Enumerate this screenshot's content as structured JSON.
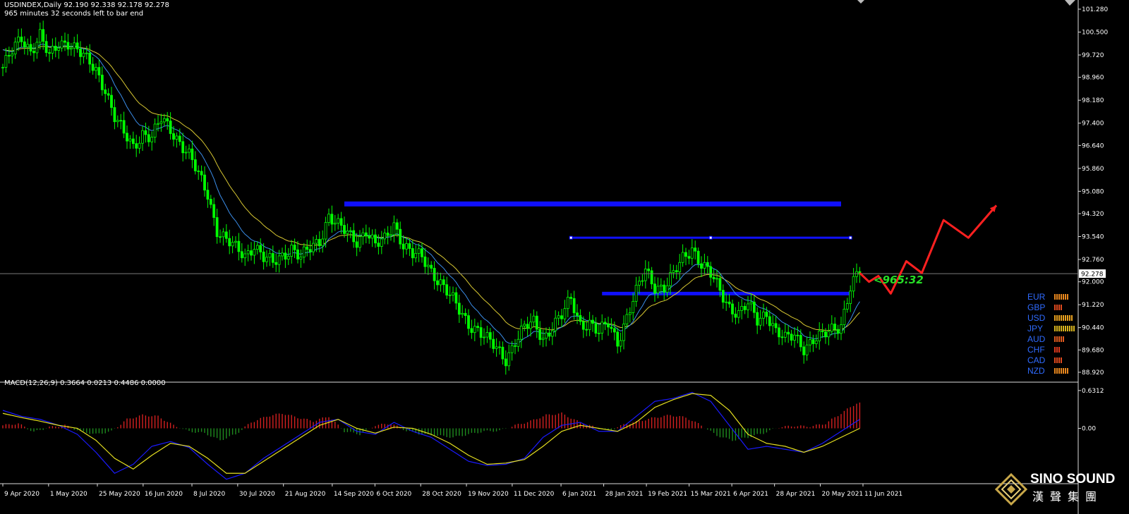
{
  "header": {
    "symbol_line": "USDINDEX,Daily  92.190 92.338 92.178 92.278",
    "timer_line": "965 minutes 32 seconds left to bar end",
    "macd_line": "MACD(12,26,9) 0.3664 0.0213 0.4486 0.0000"
  },
  "timer_label": "<965:32",
  "current_price_label": "92.278",
  "price_axis": [
    "101.280",
    "100.500",
    "99.720",
    "98.960",
    "98.180",
    "97.400",
    "96.640",
    "95.860",
    "95.080",
    "94.320",
    "93.540",
    "92.760",
    "92.000",
    "91.220",
    "90.440",
    "89.680",
    "88.920"
  ],
  "macd_axis": [
    "0.6312",
    "0.00"
  ],
  "date_axis": [
    "9 Apr 2020",
    "1 May 2020",
    "25 May 2020",
    "16 Jun 2020",
    "8 Jul 2020",
    "30 Jul 2020",
    "21 Aug 2020",
    "14 Sep 2020",
    "6 Oct 2020",
    "28 Oct 2020",
    "19 Nov 2020",
    "11 Dec 2020",
    "6 Jan 2021",
    "28 Jan 2021",
    "19 Feb 2021",
    "15 Mar 2021",
    "6 Apr 2021",
    "28 Apr 2021",
    "20 May 2021",
    "11 Jun 2021"
  ],
  "currency_strength": [
    {
      "name": "EUR",
      "level": 7,
      "color": "#e8871e"
    },
    {
      "name": "GBP",
      "level": 4,
      "color": "#e04a1e"
    },
    {
      "name": "USD",
      "level": 9,
      "color": "#e8a01e"
    },
    {
      "name": "JPY",
      "level": 10,
      "color": "#d8b41e"
    },
    {
      "name": "AUD",
      "level": 5,
      "color": "#e05a1e"
    },
    {
      "name": "CHF",
      "level": 3,
      "color": "#e03a1e"
    },
    {
      "name": "CAD",
      "level": 4,
      "color": "#e04a1e"
    },
    {
      "name": "NZD",
      "level": 7,
      "color": "#e8871e"
    }
  ],
  "logo": {
    "name": "SINO SOUND",
    "chinese": "漢聲集團"
  },
  "colors": {
    "bull": "#00ff00",
    "ma_fast": "#3b8eea",
    "ma_slow": "#d8c832",
    "level": "#1010ff",
    "forecast": "#ff2020",
    "macd_main": "#1a1aff",
    "macd_signal": "#e6e020",
    "hist_up": "#d42020",
    "hist_down": "#1e8a1e"
  },
  "chart_data": {
    "type": "candlestick",
    "price_range": [
      88.92,
      101.28
    ],
    "closes": [
      [
        0,
        99.3
      ],
      [
        3,
        99.8
      ],
      [
        6,
        100.3
      ],
      [
        9,
        99.9
      ],
      [
        12,
        100.4
      ],
      [
        15,
        99.6
      ],
      [
        18,
        100.1
      ],
      [
        21,
        100.2
      ],
      [
        24,
        99.9
      ],
      [
        27,
        99.5
      ],
      [
        30,
        99.2
      ],
      [
        33,
        98.6
      ],
      [
        36,
        97.6
      ],
      [
        39,
        97.0
      ],
      [
        42,
        96.6
      ],
      [
        45,
        97.1
      ],
      [
        48,
        96.9
      ],
      [
        51,
        97.5
      ],
      [
        54,
        97.2
      ],
      [
        57,
        96.8
      ],
      [
        60,
        96.3
      ],
      [
        63,
        95.6
      ],
      [
        66,
        95.0
      ],
      [
        69,
        93.8
      ],
      [
        72,
        93.4
      ],
      [
        75,
        93.1
      ],
      [
        78,
        92.9
      ],
      [
        81,
        93.3
      ],
      [
        84,
        92.8
      ],
      [
        87,
        92.6
      ],
      [
        90,
        92.9
      ],
      [
        93,
        93.2
      ],
      [
        96,
        92.8
      ],
      [
        99,
        93.1
      ],
      [
        102,
        93.4
      ],
      [
        105,
        94.3
      ],
      [
        108,
        93.9
      ],
      [
        111,
        93.6
      ],
      [
        114,
        93.4
      ],
      [
        117,
        93.8
      ],
      [
        120,
        93.2
      ],
      [
        123,
        93.4
      ],
      [
        126,
        94.0
      ],
      [
        129,
        93.3
      ],
      [
        132,
        92.9
      ],
      [
        135,
        92.8
      ],
      [
        138,
        92.4
      ],
      [
        141,
        92.0
      ],
      [
        144,
        91.5
      ],
      [
        147,
        91.0
      ],
      [
        150,
        90.6
      ],
      [
        153,
        90.4
      ],
      [
        156,
        90.0
      ],
      [
        159,
        89.7
      ],
      [
        162,
        89.4
      ],
      [
        165,
        90.0
      ],
      [
        168,
        90.4
      ],
      [
        171,
        90.6
      ],
      [
        174,
        90.1
      ],
      [
        177,
        90.5
      ],
      [
        180,
        90.8
      ],
      [
        183,
        91.4
      ],
      [
        186,
        90.6
      ],
      [
        189,
        90.6
      ],
      [
        192,
        90.2
      ],
      [
        195,
        90.6
      ],
      [
        198,
        90.0
      ],
      [
        201,
        90.8
      ],
      [
        204,
        91.6
      ],
      [
        207,
        92.4
      ],
      [
        210,
        91.9
      ],
      [
        213,
        91.8
      ],
      [
        216,
        92.2
      ],
      [
        219,
        92.8
      ],
      [
        222,
        93.2
      ],
      [
        225,
        92.6
      ],
      [
        228,
        92.2
      ],
      [
        231,
        91.7
      ],
      [
        234,
        91.2
      ],
      [
        237,
        90.9
      ],
      [
        240,
        91.2
      ],
      [
        243,
        90.7
      ],
      [
        246,
        91.0
      ],
      [
        249,
        90.3
      ],
      [
        252,
        90.0
      ],
      [
        255,
        90.2
      ],
      [
        258,
        89.8
      ],
      [
        261,
        90.0
      ],
      [
        264,
        90.1
      ],
      [
        267,
        90.4
      ],
      [
        270,
        90.6
      ],
      [
        273,
        91.8
      ],
      [
        276,
        92.3
      ]
    ],
    "levels": [
      {
        "price": 94.65,
        "from": 110,
        "to": 270,
        "weight": "thick"
      },
      {
        "price": 93.5,
        "from": 183,
        "to": 273,
        "weight": "thin"
      },
      {
        "price": 91.6,
        "from": 193,
        "to": 273,
        "weight": "medium"
      }
    ],
    "forecast": [
      [
        276,
        92.3
      ],
      [
        279,
        92.0
      ],
      [
        282,
        92.2
      ],
      [
        286,
        91.6
      ],
      [
        291,
        92.7
      ],
      [
        296,
        92.3
      ],
      [
        303,
        94.1
      ],
      [
        311,
        93.5
      ],
      [
        320,
        94.6
      ]
    ],
    "macd": {
      "range": [
        -0.9,
        0.7
      ],
      "hist": [
        [
          0,
          0.05
        ],
        [
          5,
          0.08
        ],
        [
          10,
          -0.06
        ],
        [
          15,
          0.02
        ],
        [
          20,
          0.05
        ],
        [
          25,
          -0.05
        ],
        [
          30,
          -0.1
        ],
        [
          35,
          -0.05
        ],
        [
          40,
          0.15
        ],
        [
          45,
          0.22
        ],
        [
          50,
          0.2
        ],
        [
          55,
          0.05
        ],
        [
          60,
          -0.05
        ],
        [
          65,
          -0.08
        ],
        [
          70,
          -0.2
        ],
        [
          75,
          -0.1
        ],
        [
          80,
          0.1
        ],
        [
          85,
          0.2
        ],
        [
          90,
          0.25
        ],
        [
          95,
          0.18
        ],
        [
          100,
          0.12
        ],
        [
          105,
          0.2
        ],
        [
          110,
          -0.05
        ],
        [
          115,
          -0.1
        ],
        [
          120,
          0.05
        ],
        [
          125,
          0.08
        ],
        [
          130,
          -0.04
        ],
        [
          135,
          -0.1
        ],
        [
          140,
          -0.12
        ],
        [
          145,
          -0.15
        ],
        [
          150,
          -0.1
        ],
        [
          155,
          -0.05
        ],
        [
          160,
          -0.04
        ],
        [
          165,
          0.05
        ],
        [
          170,
          0.12
        ],
        [
          175,
          0.22
        ],
        [
          180,
          0.25
        ],
        [
          185,
          0.12
        ],
        [
          190,
          0.03
        ],
        [
          195,
          -0.04
        ],
        [
          200,
          0.06
        ],
        [
          205,
          0.12
        ],
        [
          210,
          0.18
        ],
        [
          215,
          0.22
        ],
        [
          220,
          0.18
        ],
        [
          225,
          0.05
        ],
        [
          230,
          -0.12
        ],
        [
          235,
          -0.2
        ],
        [
          240,
          -0.15
        ],
        [
          245,
          -0.08
        ],
        [
          250,
          0.02
        ],
        [
          255,
          0.04
        ],
        [
          260,
          0.03
        ],
        [
          265,
          0.08
        ],
        [
          270,
          0.25
        ],
        [
          275,
          0.42
        ]
      ],
      "main": [
        [
          0,
          0.3
        ],
        [
          6,
          0.2
        ],
        [
          12,
          0.15
        ],
        [
          18,
          0.05
        ],
        [
          24,
          -0.1
        ],
        [
          30,
          -0.4
        ],
        [
          36,
          -0.75
        ],
        [
          42,
          -0.6
        ],
        [
          48,
          -0.3
        ],
        [
          54,
          -0.22
        ],
        [
          60,
          -0.32
        ],
        [
          66,
          -0.6
        ],
        [
          72,
          -0.85
        ],
        [
          78,
          -0.75
        ],
        [
          84,
          -0.5
        ],
        [
          90,
          -0.3
        ],
        [
          96,
          -0.1
        ],
        [
          102,
          0.1
        ],
        [
          108,
          0.15
        ],
        [
          114,
          -0.05
        ],
        [
          120,
          -0.1
        ],
        [
          126,
          0.1
        ],
        [
          132,
          -0.05
        ],
        [
          138,
          -0.15
        ],
        [
          144,
          -0.35
        ],
        [
          150,
          -0.55
        ],
        [
          156,
          -0.62
        ],
        [
          162,
          -0.6
        ],
        [
          168,
          -0.5
        ],
        [
          174,
          -0.15
        ],
        [
          180,
          0.05
        ],
        [
          186,
          0.1
        ],
        [
          192,
          -0.05
        ],
        [
          198,
          -0.05
        ],
        [
          204,
          0.2
        ],
        [
          210,
          0.45
        ],
        [
          216,
          0.5
        ],
        [
          222,
          0.6
        ],
        [
          228,
          0.45
        ],
        [
          234,
          0.05
        ],
        [
          240,
          -0.35
        ],
        [
          246,
          -0.3
        ],
        [
          252,
          -0.35
        ],
        [
          258,
          -0.4
        ],
        [
          264,
          -0.25
        ],
        [
          270,
          -0.05
        ],
        [
          276,
          0.15
        ]
      ],
      "signal": [
        [
          0,
          0.25
        ],
        [
          6,
          0.18
        ],
        [
          12,
          0.12
        ],
        [
          18,
          0.05
        ],
        [
          24,
          0.0
        ],
        [
          30,
          -0.2
        ],
        [
          36,
          -0.5
        ],
        [
          42,
          -0.68
        ],
        [
          48,
          -0.45
        ],
        [
          54,
          -0.25
        ],
        [
          60,
          -0.3
        ],
        [
          66,
          -0.5
        ],
        [
          72,
          -0.75
        ],
        [
          78,
          -0.75
        ],
        [
          84,
          -0.55
        ],
        [
          90,
          -0.35
        ],
        [
          96,
          -0.15
        ],
        [
          102,
          0.05
        ],
        [
          108,
          0.15
        ],
        [
          114,
          0.0
        ],
        [
          120,
          -0.08
        ],
        [
          126,
          0.02
        ],
        [
          132,
          0.0
        ],
        [
          138,
          -0.1
        ],
        [
          144,
          -0.25
        ],
        [
          150,
          -0.45
        ],
        [
          156,
          -0.6
        ],
        [
          162,
          -0.58
        ],
        [
          168,
          -0.52
        ],
        [
          174,
          -0.3
        ],
        [
          180,
          -0.05
        ],
        [
          186,
          0.05
        ],
        [
          192,
          0.0
        ],
        [
          198,
          -0.05
        ],
        [
          204,
          0.1
        ],
        [
          210,
          0.35
        ],
        [
          216,
          0.48
        ],
        [
          222,
          0.58
        ],
        [
          228,
          0.55
        ],
        [
          234,
          0.3
        ],
        [
          240,
          -0.1
        ],
        [
          246,
          -0.25
        ],
        [
          252,
          -0.3
        ],
        [
          258,
          -0.4
        ],
        [
          264,
          -0.3
        ],
        [
          270,
          -0.15
        ],
        [
          276,
          0.0
        ]
      ]
    }
  }
}
